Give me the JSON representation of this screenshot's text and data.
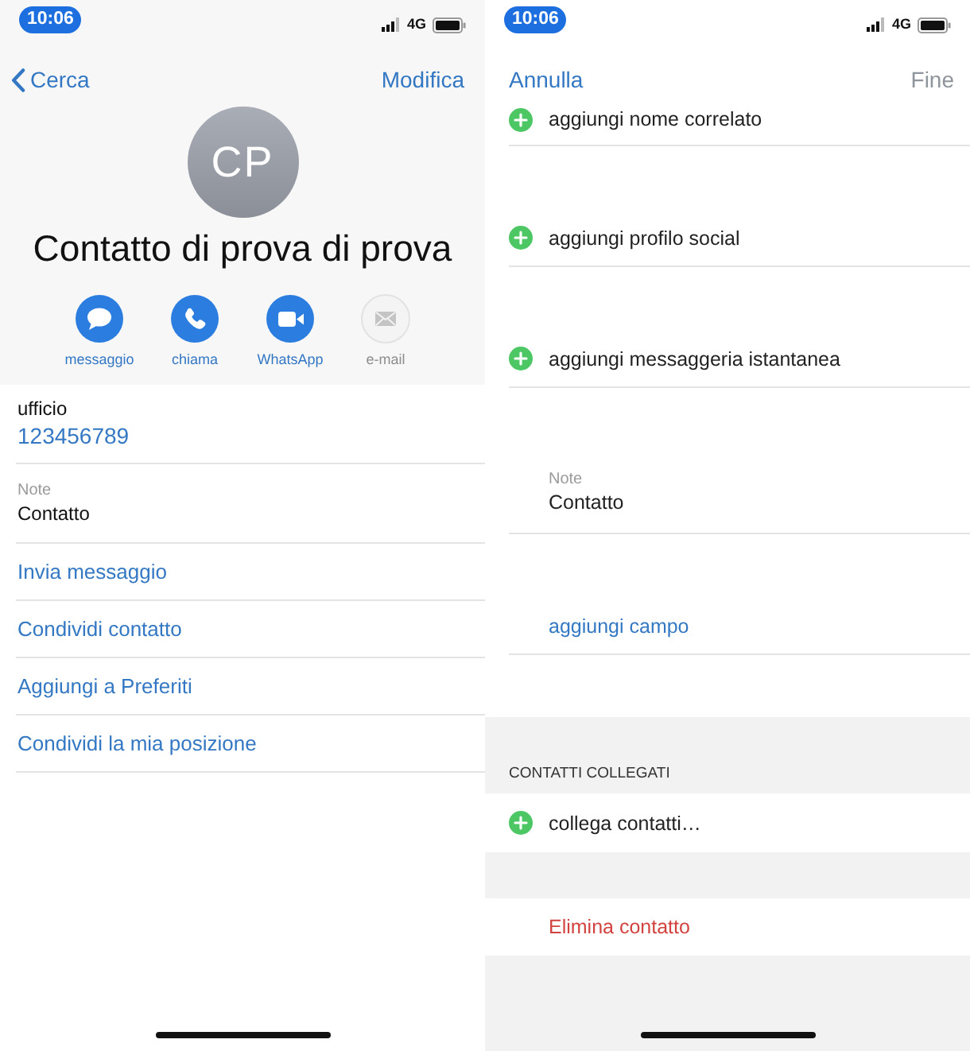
{
  "contact_screen": {
    "status_bar": {
      "time": "10:06",
      "network": "4G"
    },
    "nav": {
      "back": "Cerca",
      "action": {
        "label": "Modifica",
        "disabled": false
      }
    },
    "avatar": {
      "initials": "CP"
    },
    "name": "Contatto di prova di prova",
    "actions": [
      {
        "kind": "message",
        "label": "messaggio",
        "disabled": false
      },
      {
        "kind": "call",
        "label": "chiama",
        "disabled": false
      },
      {
        "kind": "video",
        "label": "WhatsApp",
        "disabled": false
      },
      {
        "kind": "mail",
        "label": "e-mail",
        "disabled": true
      }
    ],
    "fields": [
      {
        "kind": "phone",
        "label": "ufficio",
        "value": "123456789"
      },
      {
        "kind": "note",
        "label": "Note",
        "value": "Contatto"
      }
    ],
    "links": [
      "Invia messaggio",
      "Condividi contatto",
      "Aggiungi a Preferiti",
      "Condividi la mia posizione"
    ]
  },
  "edit_screen": {
    "status_bar": {
      "time": "10:06",
      "network": "4G"
    },
    "nav": {
      "cancel": "Annulla",
      "action": {
        "label": "Fine",
        "disabled": true
      }
    },
    "rows": [
      {
        "kind": "add",
        "label": "aggiungi nome correlato"
      },
      {
        "kind": "add",
        "label": "aggiungi profilo social"
      },
      {
        "kind": "add",
        "label": "aggiungi messaggeria istantanea"
      },
      {
        "kind": "note",
        "label": "Note",
        "value": "Contatto"
      },
      {
        "kind": "link",
        "label": "aggiungi campo"
      }
    ],
    "linked_contacts": {
      "header": "CONTATTI COLLEGATI",
      "rows": [
        {
          "kind": "add",
          "label": "collega contatti…"
        }
      ]
    },
    "delete_button": "Elimina contatto"
  }
}
